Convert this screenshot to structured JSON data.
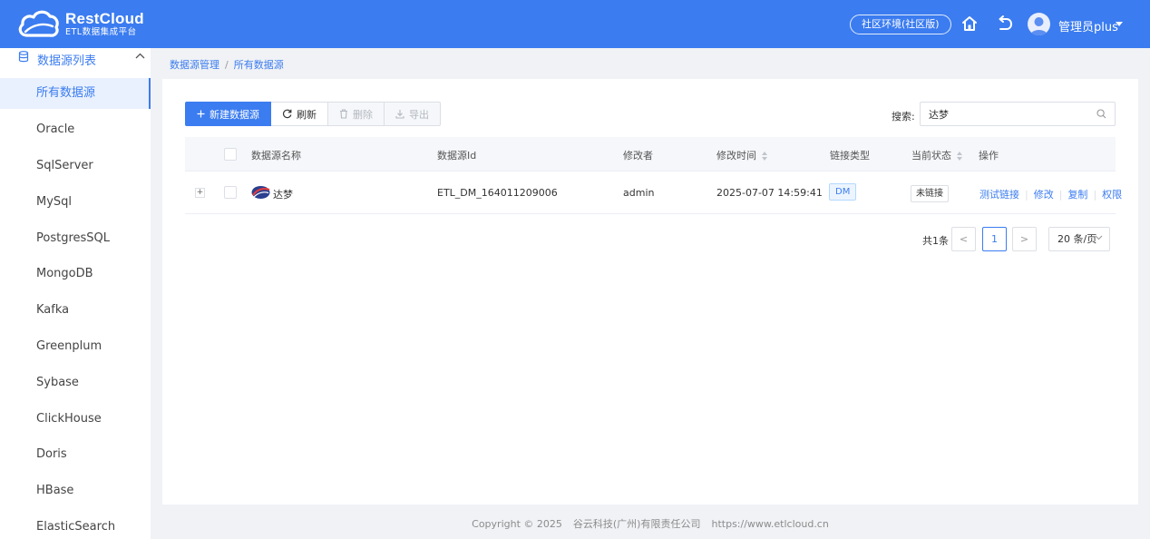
{
  "header": {
    "logo_title": "RestCloud",
    "logo_subtitle": "ETL数据集成平台",
    "env_label": "社区环境(社区版)",
    "user_name": "管理员plus"
  },
  "sidebar": {
    "group_label": "数据源列表",
    "items": [
      {
        "label": "所有数据源",
        "active": true
      },
      {
        "label": "Oracle"
      },
      {
        "label": "SqlServer"
      },
      {
        "label": "MySql"
      },
      {
        "label": "PostgresSQL"
      },
      {
        "label": "MongoDB"
      },
      {
        "label": "Kafka"
      },
      {
        "label": "Greenplum"
      },
      {
        "label": "Sybase"
      },
      {
        "label": "ClickHouse"
      },
      {
        "label": "Doris"
      },
      {
        "label": "HBase"
      },
      {
        "label": "ElasticSearch"
      }
    ]
  },
  "breadcrumb": {
    "parent": "数据源管理",
    "separator": "/",
    "current": "所有数据源"
  },
  "toolbar": {
    "new_label": "新建数据源",
    "refresh_label": "刷新",
    "delete_label": "删除",
    "export_label": "导出"
  },
  "search": {
    "label": "搜索:",
    "value": "达梦"
  },
  "table": {
    "headers": {
      "name": "数据源名称",
      "id": "数据源Id",
      "modifier": "修改者",
      "modified_time": "修改时间",
      "link_type": "链接类型",
      "status": "当前状态",
      "ops": "操作"
    },
    "rows": [
      {
        "expand": "+",
        "name": "达梦",
        "id": "ETL_DM_164011209006",
        "modifier": "admin",
        "modified_time": "2025-07-07 14:59:41",
        "link_type": "DM",
        "status": "未链接",
        "ops": {
          "test": "测试链接",
          "edit": "修改",
          "copy": "复制",
          "perm": "权限",
          "divider": "|"
        }
      }
    ]
  },
  "pagination": {
    "total": "共1条",
    "prev": "<",
    "current_page": "1",
    "next": ">",
    "page_size": "20 条/页"
  },
  "footer": {
    "copyright": "Copyright © 2025",
    "company": "谷云科技(广州)有限责任公司",
    "url": "https://www.etlcloud.cn"
  },
  "colors": {
    "primary": "#3b7cf0",
    "header_bg": "#3b7cf0",
    "page_bg": "#f0f2f5"
  }
}
